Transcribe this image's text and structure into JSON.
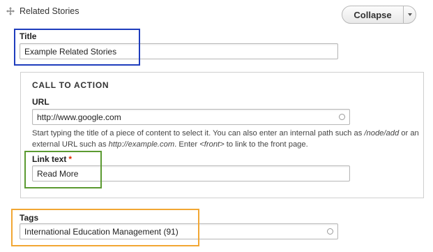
{
  "section": {
    "title": "Related Stories",
    "collapse_label": "Collapse"
  },
  "title_field": {
    "label": "Title",
    "value": "Example Related Stories"
  },
  "cta": {
    "legend": "CALL TO ACTION",
    "url_label": "URL",
    "url_value": "http://www.google.com",
    "desc_part1": "Start typing the title of a piece of content to select it. You can also enter an internal path such as ",
    "desc_em1": "/node/add",
    "desc_part2": " or an external URL such as ",
    "desc_em2": "http://example.com",
    "desc_part3": ". Enter ",
    "desc_em3": "<front>",
    "desc_part4": " to link to the front page.",
    "link_text_label": "Link text",
    "required_marker": "*",
    "link_text_value": "Read More"
  },
  "tags": {
    "label": "Tags",
    "value": "International Education Management (91)"
  },
  "colors": {
    "highlight_blue": "#1f3dbd",
    "highlight_green": "#5b9a31",
    "highlight_orange": "#f2a733",
    "required": "#e32700"
  },
  "icons": {
    "drag": "move-arrows-icon",
    "dropdown": "caret-down-icon",
    "autocomplete": "autocomplete-circle-icon"
  }
}
